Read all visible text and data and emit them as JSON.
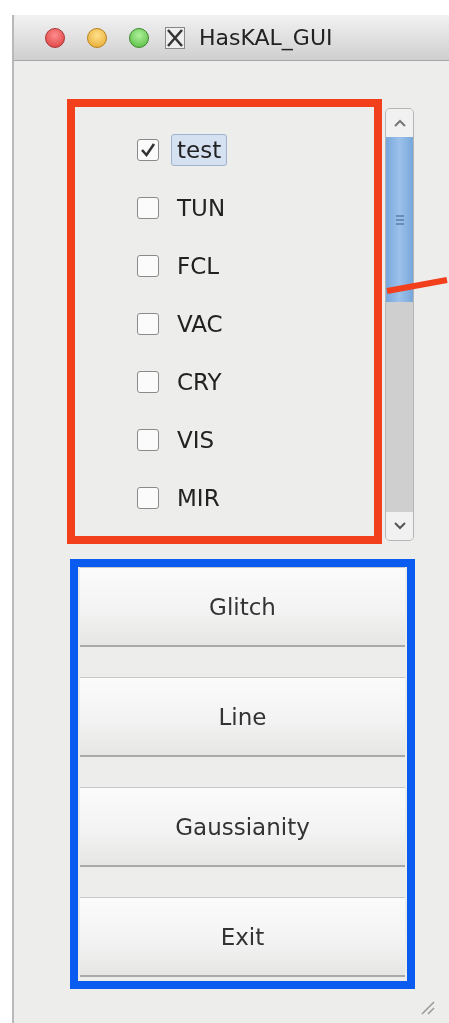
{
  "window": {
    "title": "HasKAL_GUI"
  },
  "annotations": [
    {
      "kind": "box",
      "color": "#f2401c"
    },
    {
      "kind": "line",
      "color": "#f2401c"
    },
    {
      "kind": "box",
      "color": "#0a5cf0"
    }
  ],
  "channel_list": {
    "items": [
      {
        "label": "test",
        "checked": true,
        "selected": true
      },
      {
        "label": "TUN",
        "checked": false,
        "selected": false
      },
      {
        "label": "FCL",
        "checked": false,
        "selected": false
      },
      {
        "label": "VAC",
        "checked": false,
        "selected": false
      },
      {
        "label": "CRY",
        "checked": false,
        "selected": false
      },
      {
        "label": "VIS",
        "checked": false,
        "selected": false
      },
      {
        "label": "MIR",
        "checked": false,
        "selected": false
      }
    ]
  },
  "actions": {
    "buttons": [
      "Glitch",
      "Line",
      "Gaussianity",
      "Exit"
    ]
  }
}
